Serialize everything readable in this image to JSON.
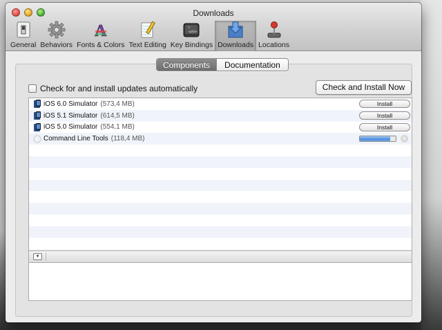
{
  "window": {
    "title": "Downloads"
  },
  "toolbar": {
    "items": [
      {
        "label": "General",
        "icon": "general-switch-icon"
      },
      {
        "label": "Behaviors",
        "icon": "gear-icon"
      },
      {
        "label": "Fonts & Colors",
        "icon": "fonts-colors-icon"
      },
      {
        "label": "Text Editing",
        "icon": "notepad-pencil-icon"
      },
      {
        "label": "Key Bindings",
        "icon": "keyboard-key-icon"
      },
      {
        "label": "Downloads",
        "icon": "download-tray-icon",
        "selected": true
      },
      {
        "label": "Locations",
        "icon": "joystick-icon"
      }
    ]
  },
  "tabs": {
    "components": "Components",
    "documentation": "Documentation",
    "active": "Components"
  },
  "auto_update": {
    "label": "Check for and install updates automatically",
    "checked": false
  },
  "check_button": {
    "label": "Check and Install Now"
  },
  "components": [
    {
      "name": "iOS 6.0 Simulator",
      "size": "(573,4 MB)",
      "action": "Install",
      "icon": "ios-simulator-icon"
    },
    {
      "name": "iOS 5.1 Simulator",
      "size": "(614,5 MB)",
      "action": "Install",
      "icon": "ios-simulator-icon"
    },
    {
      "name": "iOS 5.0 Simulator",
      "size": "(554,1 MB)",
      "action": "Install",
      "icon": "ios-simulator-icon"
    },
    {
      "name": "Command Line Tools",
      "size": "(118,4 MB)",
      "progress": 0.85,
      "icon": "spinner-icon"
    }
  ],
  "colors": {
    "accent": "#4f8fdd",
    "selected_segment": "#7e7e7e",
    "row_stripe": "#f0f4fa"
  }
}
